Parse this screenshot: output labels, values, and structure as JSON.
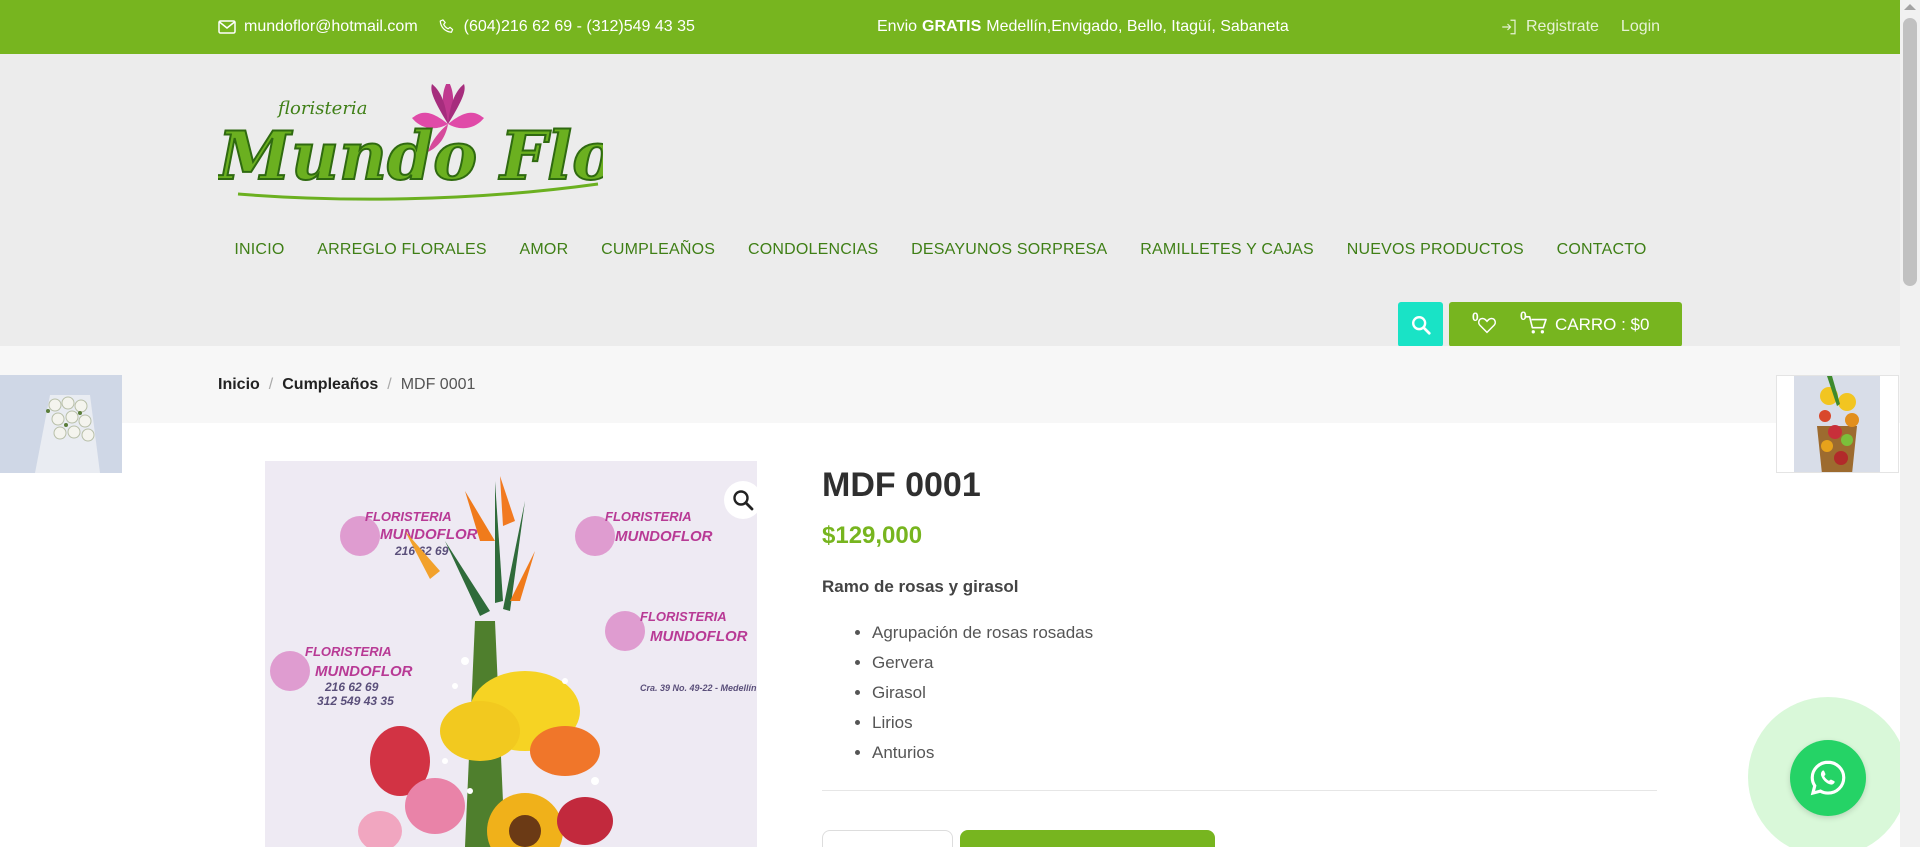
{
  "topbar": {
    "email": "mundoflor@hotmail.com",
    "phone": "(604)216 62 69 - (312)549 43 35",
    "shipping_prefix": "Envio",
    "shipping_bold": "GRATIS",
    "shipping_cities": "Medellín,Envigado, Bello, Itagüí, Sabaneta",
    "register_label": "Registrate",
    "login_label": "Login"
  },
  "logo": {
    "small_text": "floristeria",
    "main_text": "Mundo Flor"
  },
  "nav": {
    "items": [
      "INICIO",
      "ARREGLO FLORALES",
      "AMOR",
      "CUMPLEAÑOS",
      "CONDOLENCIAS",
      "DESAYUNOS SORPRESA",
      "RAMILLETES Y CAJAS",
      "NUEVOS PRODUCTOS",
      "CONTACTO"
    ]
  },
  "cart": {
    "wishlist_count": "0",
    "cart_count": "0",
    "label": "CARRO : $0"
  },
  "breadcrumb": {
    "home": "Inicio",
    "category": "Cumpleaños",
    "current": "MDF 0001",
    "separator": "/"
  },
  "product": {
    "title": "MDF 0001",
    "price": "$129,000",
    "description": "Ramo de rosas y girasol",
    "features": [
      "Agrupación de rosas rosadas",
      "Gervera",
      "Girasol",
      "Lirios",
      "Anturios"
    ]
  },
  "image_watermark": {
    "brand1": "FLORISTERIA",
    "brand2": "MUNDOFLOR",
    "phone1": "216 62 69",
    "phone2": "312 549 43 35",
    "address": "Cra. 39 No. 49-22 - Medellín"
  },
  "colors": {
    "topbar": "#77b51f",
    "nav_text": "#3f7f16",
    "search_button": "#19e3c6",
    "price": "#77b51f",
    "whatsapp": "#25d366"
  },
  "icons": {
    "email": "envelope-icon",
    "phone": "phone-icon",
    "register": "login-arrow-icon",
    "search": "search-icon",
    "wishlist": "heart-icon",
    "cart": "cart-icon",
    "zoom": "magnifier-icon",
    "whatsapp": "whatsapp-icon"
  }
}
